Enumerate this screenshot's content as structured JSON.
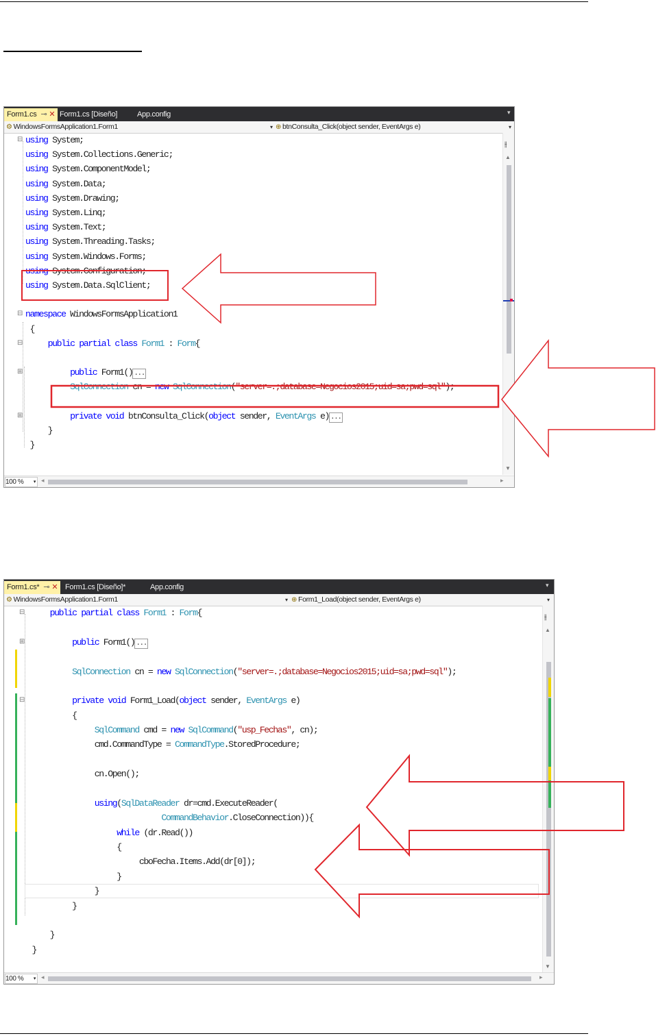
{
  "screenshot1": {
    "tabs": [
      {
        "label": "Form1.cs",
        "active": true
      },
      {
        "label": "Form1.cs [Diseño]",
        "active": false
      },
      {
        "label": "App.config",
        "active": false
      }
    ],
    "nav": {
      "left": "WindowsFormsApplication1.Form1",
      "right": "btnConsulta_Click(object sender, EventArgs e)"
    },
    "zoom": "100 %",
    "code": [
      {
        "fold": "minus",
        "segs": [
          {
            "t": "using",
            "c": "kw"
          },
          {
            "t": " System;"
          }
        ]
      },
      {
        "segs": [
          {
            "t": "using",
            "c": "kw"
          },
          {
            "t": " System.Collections.Generic;"
          }
        ]
      },
      {
        "segs": [
          {
            "t": "using",
            "c": "kw"
          },
          {
            "t": " System.ComponentModel;"
          }
        ]
      },
      {
        "segs": [
          {
            "t": "using",
            "c": "kw"
          },
          {
            "t": " System.Data;"
          }
        ]
      },
      {
        "segs": [
          {
            "t": "using",
            "c": "kw"
          },
          {
            "t": " System.Drawing;"
          }
        ]
      },
      {
        "segs": [
          {
            "t": "using",
            "c": "kw"
          },
          {
            "t": " System.Linq;"
          }
        ]
      },
      {
        "segs": [
          {
            "t": "using",
            "c": "kw"
          },
          {
            "t": " System.Text;"
          }
        ]
      },
      {
        "segs": [
          {
            "t": "using",
            "c": "kw"
          },
          {
            "t": " System.Threading.Tasks;"
          }
        ]
      },
      {
        "segs": [
          {
            "t": "using",
            "c": "kw"
          },
          {
            "t": " System.Windows.Forms;"
          }
        ]
      },
      {
        "segs": [
          {
            "t": "using",
            "c": "kw"
          },
          {
            "t": " System.Configuration;"
          }
        ]
      },
      {
        "segs": [
          {
            "t": "using",
            "c": "kw"
          },
          {
            "t": " System.Data.SqlClient;"
          }
        ]
      },
      {
        "segs": []
      },
      {
        "fold": "minus",
        "segs": [
          {
            "t": "namespace",
            "c": "kw"
          },
          {
            "t": " WindowsFormsApplication1"
          }
        ]
      },
      {
        "segs": [
          {
            "t": " {"
          }
        ]
      },
      {
        "fold": "minus",
        "segs": [
          {
            "t": "     "
          },
          {
            "t": "public",
            "c": "kw"
          },
          {
            "t": " "
          },
          {
            "t": "partial",
            "c": "kw"
          },
          {
            "t": " "
          },
          {
            "t": "class",
            "c": "kw"
          },
          {
            "t": " "
          },
          {
            "t": "Form1",
            "c": "ty"
          },
          {
            "t": " : "
          },
          {
            "t": "Form",
            "c": "ty"
          },
          {
            "t": "{"
          }
        ]
      },
      {
        "segs": []
      },
      {
        "fold": "plus",
        "segs": [
          {
            "t": "          "
          },
          {
            "t": "public",
            "c": "kw"
          },
          {
            "t": " Form1()"
          },
          {
            "t": "...",
            "c": "box"
          }
        ]
      },
      {
        "segs": [
          {
            "t": "          "
          },
          {
            "t": "SqlConnection",
            "c": "ty"
          },
          {
            "t": " cn = "
          },
          {
            "t": "new",
            "c": "kw"
          },
          {
            "t": " "
          },
          {
            "t": "SqlConnection",
            "c": "ty"
          },
          {
            "t": "("
          },
          {
            "t": "\"server=.;database=Negocios2015;uid=sa;pwd=sql\"",
            "c": "str"
          },
          {
            "t": ");"
          }
        ]
      },
      {
        "segs": []
      },
      {
        "fold": "plus",
        "segs": [
          {
            "t": "          "
          },
          {
            "t": "private",
            "c": "kw"
          },
          {
            "t": " "
          },
          {
            "t": "void",
            "c": "kw"
          },
          {
            "t": " btnConsulta_Click("
          },
          {
            "t": "object",
            "c": "kw"
          },
          {
            "t": " sender, "
          },
          {
            "t": "EventArgs",
            "c": "ty"
          },
          {
            "t": " e)"
          },
          {
            "t": "...",
            "c": "box"
          }
        ]
      },
      {
        "segs": [
          {
            "t": "     }"
          }
        ]
      },
      {
        "segs": [
          {
            "t": " }"
          }
        ]
      }
    ]
  },
  "screenshot2": {
    "tabs": [
      {
        "label": "Form1.cs*",
        "active": true
      },
      {
        "label": "Form1.cs [Diseño]*",
        "active": false
      },
      {
        "label": "App.config",
        "active": false
      }
    ],
    "nav": {
      "left": "WindowsFormsApplication1.Form1",
      "right": "Form1_Load(object sender, EventArgs e)"
    },
    "zoom": "100 %",
    "code": [
      {
        "fold": "minus",
        "segs": [
          {
            "t": "     "
          },
          {
            "t": "public",
            "c": "kw"
          },
          {
            "t": " "
          },
          {
            "t": "partial",
            "c": "kw"
          },
          {
            "t": " "
          },
          {
            "t": "class",
            "c": "kw"
          },
          {
            "t": " "
          },
          {
            "t": "Form1",
            "c": "ty"
          },
          {
            "t": " : "
          },
          {
            "t": "Form",
            "c": "ty"
          },
          {
            "t": "{"
          }
        ]
      },
      {
        "segs": []
      },
      {
        "fold": "plus",
        "segs": [
          {
            "t": "          "
          },
          {
            "t": "public",
            "c": "kw"
          },
          {
            "t": " Form1()"
          },
          {
            "t": "...",
            "c": "box"
          }
        ]
      },
      {
        "segs": []
      },
      {
        "segs": [
          {
            "t": "          "
          },
          {
            "t": "SqlConnection",
            "c": "ty"
          },
          {
            "t": " cn = "
          },
          {
            "t": "new",
            "c": "kw"
          },
          {
            "t": " "
          },
          {
            "t": "SqlConnection",
            "c": "ty"
          },
          {
            "t": "("
          },
          {
            "t": "\"server=.;database=Negocios2015;uid=sa;pwd=sql\"",
            "c": "str"
          },
          {
            "t": ");"
          }
        ]
      },
      {
        "segs": []
      },
      {
        "fold": "minus",
        "segs": [
          {
            "t": "          "
          },
          {
            "t": "private",
            "c": "kw"
          },
          {
            "t": " "
          },
          {
            "t": "void",
            "c": "kw"
          },
          {
            "t": " Form1_Load("
          },
          {
            "t": "object",
            "c": "kw"
          },
          {
            "t": " sender, "
          },
          {
            "t": "EventArgs",
            "c": "ty"
          },
          {
            "t": " e)"
          }
        ]
      },
      {
        "segs": [
          {
            "t": "          {"
          }
        ]
      },
      {
        "segs": [
          {
            "t": "               "
          },
          {
            "t": "SqlCommand",
            "c": "ty"
          },
          {
            "t": " cmd = "
          },
          {
            "t": "new",
            "c": "kw"
          },
          {
            "t": " "
          },
          {
            "t": "SqlCommand",
            "c": "ty"
          },
          {
            "t": "("
          },
          {
            "t": "\"usp_Fechas\"",
            "c": "str"
          },
          {
            "t": ", cn);"
          }
        ]
      },
      {
        "segs": [
          {
            "t": "               cmd.CommandType = "
          },
          {
            "t": "CommandType",
            "c": "ty"
          },
          {
            "t": ".StoredProcedure;"
          }
        ]
      },
      {
        "segs": []
      },
      {
        "segs": [
          {
            "t": "               cn.Open();"
          }
        ]
      },
      {
        "segs": []
      },
      {
        "segs": [
          {
            "t": "               "
          },
          {
            "t": "using",
            "c": "kw"
          },
          {
            "t": "("
          },
          {
            "t": "SqlDataReader",
            "c": "ty"
          },
          {
            "t": " dr=cmd.ExecuteReader("
          }
        ]
      },
      {
        "segs": [
          {
            "t": "                              "
          },
          {
            "t": "CommandBehavior",
            "c": "ty"
          },
          {
            "t": ".CloseConnection)){"
          }
        ]
      },
      {
        "segs": [
          {
            "t": "                    "
          },
          {
            "t": "while",
            "c": "kw"
          },
          {
            "t": " (dr.Read())"
          }
        ]
      },
      {
        "segs": [
          {
            "t": "                    {"
          }
        ]
      },
      {
        "segs": [
          {
            "t": "                         cboFecha.Items.Add(dr[0]);"
          }
        ]
      },
      {
        "segs": [
          {
            "t": "                    }"
          }
        ]
      },
      {
        "segs": [
          {
            "t": "               }"
          }
        ]
      },
      {
        "segs": [
          {
            "t": "          }"
          }
        ]
      },
      {
        "segs": []
      },
      {
        "segs": [
          {
            "t": "     }"
          }
        ]
      },
      {
        "segs": [
          {
            "t": " }"
          }
        ]
      }
    ]
  }
}
